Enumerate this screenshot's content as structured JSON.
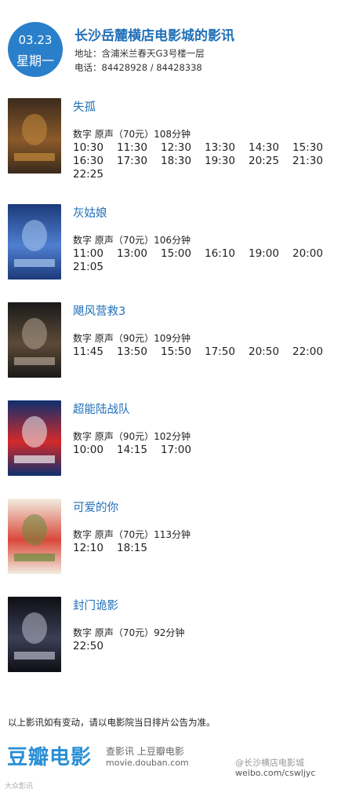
{
  "header": {
    "date": "03.23",
    "weekday": "星期一",
    "cinema_name": "长沙岳麓横店电影城的影讯",
    "address": "地址：含浦米兰春天G3号楼一层",
    "phone": "电话：84428928 / 84428338"
  },
  "movies": [
    {
      "title": "失孤",
      "meta": "数字  原声（70元）108分钟",
      "times": [
        "10:30",
        "11:30",
        "12:30",
        "13:30",
        "14:30",
        "15:30",
        "16:30",
        "17:30",
        "18:30",
        "19:30",
        "20:25",
        "21:30",
        "22:25"
      ],
      "poster_colors": [
        "#3b2a1c",
        "#8a5a2a",
        "#c58a3c"
      ]
    },
    {
      "title": "灰姑娘",
      "meta": "数字  原声（70元）106分钟",
      "times": [
        "11:00",
        "13:00",
        "15:00",
        "16:10",
        "19:00",
        "20:00",
        "21:05"
      ],
      "poster_colors": [
        "#1c3a7a",
        "#4f7fd0",
        "#a9c9f0"
      ]
    },
    {
      "title": "飓风营救3",
      "meta": "数字  原声（90元）109分钟",
      "times": [
        "11:45",
        "13:50",
        "15:50",
        "17:50",
        "20:50",
        "22:00"
      ],
      "poster_colors": [
        "#1a1a1a",
        "#5c4a38",
        "#b0a090"
      ]
    },
    {
      "title": "超能陆战队",
      "meta": "数字  原声（90元）102分钟",
      "times": [
        "10:00",
        "14:15",
        "17:00"
      ],
      "poster_colors": [
        "#0f2f6e",
        "#d32a2a",
        "#f0f0f0"
      ]
    },
    {
      "title": "可爱的你",
      "meta": "数字  原声（70元）113分钟",
      "times": [
        "12:10",
        "18:15"
      ],
      "poster_colors": [
        "#f2ede0",
        "#d9483a",
        "#6a8a3a"
      ]
    },
    {
      "title": "封门诡影",
      "meta": "数字  原声（70元）92分钟",
      "times": [
        "22:50"
      ],
      "poster_colors": [
        "#0e0e14",
        "#3a3f55",
        "#b8b8c8"
      ]
    }
  ],
  "footer": {
    "note": "以上影讯如有变动，请以电影院当日排片公告为准。",
    "logo": "豆瓣电影",
    "tagline": "查影讯  上豆瓣电影",
    "site": "movie.douban.com",
    "weibo_handle": "@长沙横店电影城",
    "weibo_url": "weibo.com/cswljyc",
    "small_logo": "大众影讯"
  }
}
